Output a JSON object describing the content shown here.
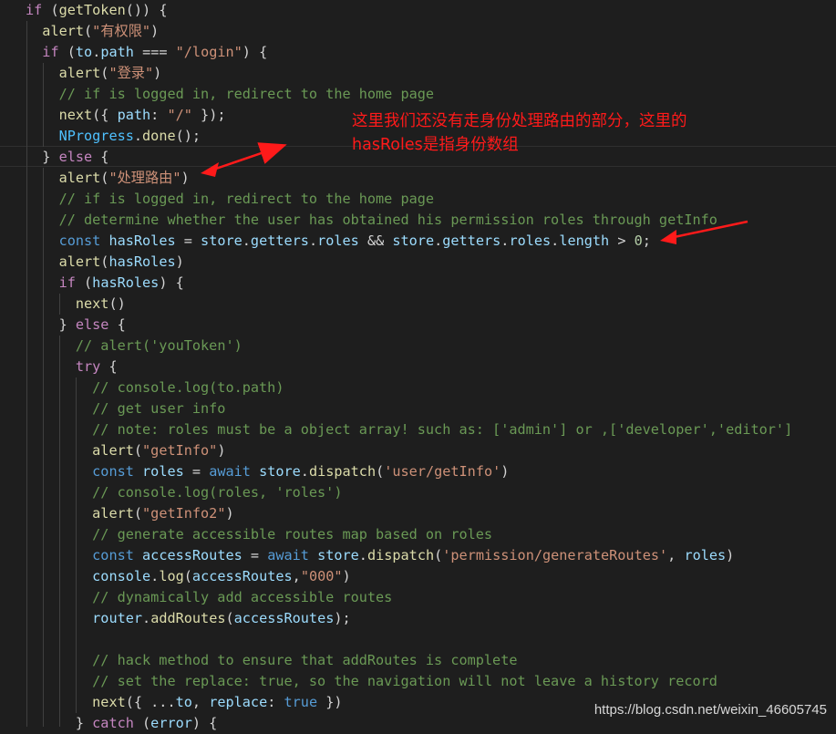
{
  "code": {
    "lines": [
      "if (getToken()) {",
      "  alert(\"有权限\")",
      "  if (to.path === \"/login\") {",
      "    alert(\"登录\")",
      "    // if is logged in, redirect to the home page",
      "    next({ path: \"/\" });",
      "    NProgress.done();",
      "  } else {",
      "    alert(\"处理路由\")",
      "    // if is logged in, redirect to the home page",
      "    // determine whether the user has obtained his permission roles through getInfo",
      "    const hasRoles = store.getters.roles && store.getters.roles.length > 0;",
      "    alert(hasRoles)",
      "    if (hasRoles) {",
      "      next()",
      "    } else {",
      "      // alert('youToken')",
      "      try {",
      "        // console.log(to.path)",
      "        // get user info",
      "        // note: roles must be a object array! such as: ['admin'] or ,['developer','editor']",
      "        alert(\"getInfo\")",
      "        const roles = await store.dispatch('user/getInfo')",
      "        // console.log(roles, 'roles')",
      "        alert(\"getInfo2\")",
      "        // generate accessible routes map based on roles",
      "        const accessRoutes = await store.dispatch('permission/generateRoutes', roles)",
      "        console.log(accessRoutes,\"000\")",
      "        // dynamically add accessible routes",
      "        router.addRoutes(accessRoutes);",
      "",
      "        // hack method to ensure that addRoutes is complete",
      "        // set the replace: true, so the navigation will not leave a history record",
      "        next({ ...to, replace: true })",
      "      } catch (error) {"
    ]
  },
  "annotation": {
    "text": "这里我们还没有走身份处理路由的部分，这里的hasRoles是指身份数组",
    "color": "#ff1a1a"
  },
  "watermark": {
    "text": "https://blog.csdn.net/weixin_46605745"
  },
  "theme": {
    "background": "#1e1e1e",
    "keyword": "#569cd6",
    "control": "#c586c0",
    "function": "#dcdcaa",
    "string": "#ce9178",
    "variable": "#9cdcfe",
    "constant": "#4fc1ff",
    "number": "#b5cea8",
    "comment": "#6a9955"
  }
}
